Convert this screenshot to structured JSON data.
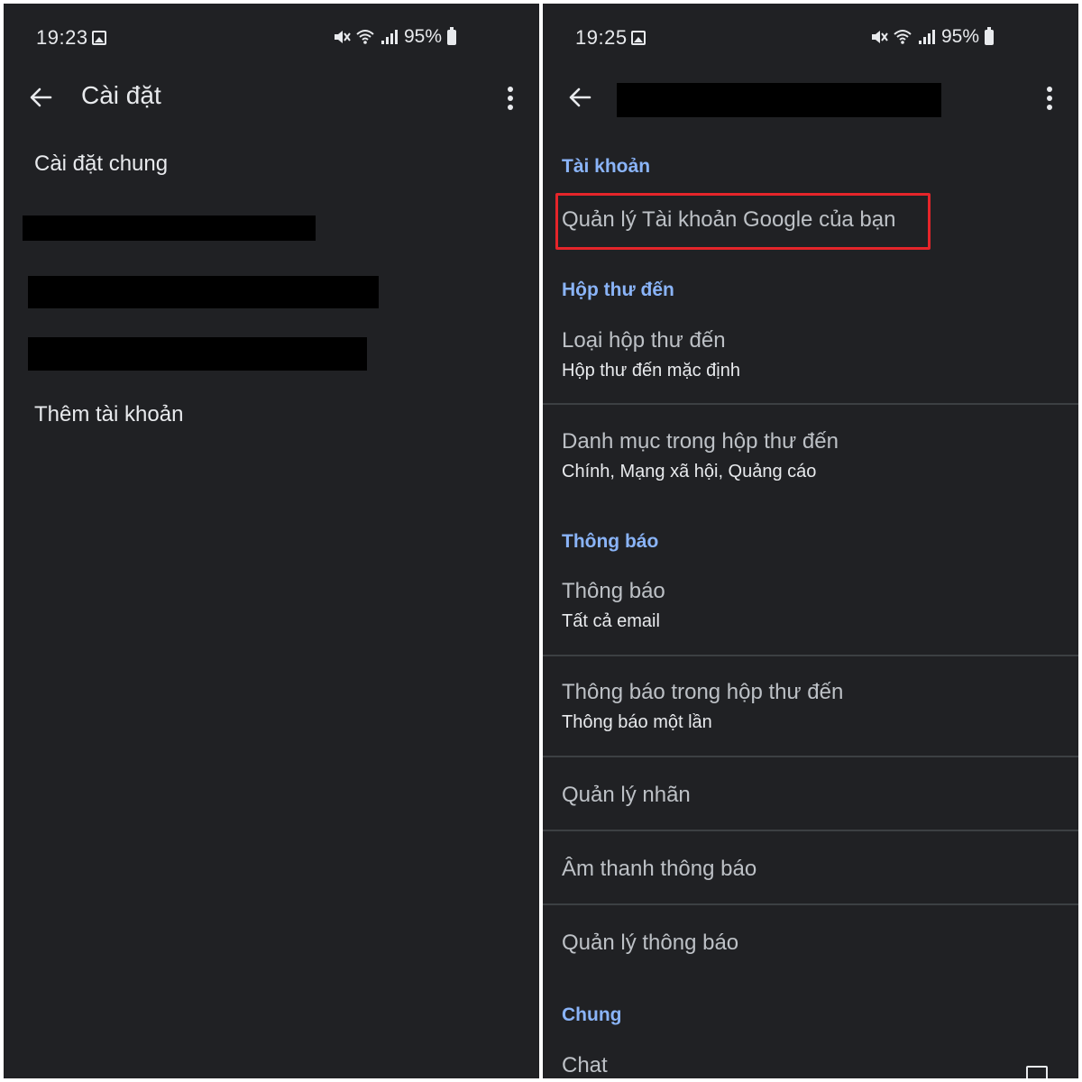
{
  "left": {
    "status": {
      "time": "19:23",
      "battery": "95%"
    },
    "app_bar": {
      "title": "Cài đặt"
    },
    "items": [
      {
        "label": "Cài đặt chung"
      },
      {
        "label": "Thêm tài khoản"
      }
    ]
  },
  "right": {
    "status": {
      "time": "19:25",
      "battery": "95%"
    },
    "sections": {
      "account": "Tài khoản",
      "inbox": "Hộp thư đến",
      "notifications": "Thông báo",
      "general": "Chung"
    },
    "items": {
      "manage_account": {
        "title": "Quản lý Tài khoản Google của bạn"
      },
      "inbox_type": {
        "title": "Loại hộp thư đến",
        "summary": "Hộp thư đến mặc định"
      },
      "inbox_categories": {
        "title": "Danh mục trong hộp thư đến",
        "summary": "Chính, Mạng xã hội, Quảng cáo"
      },
      "notifications": {
        "title": "Thông báo",
        "summary": "Tất cả email"
      },
      "inbox_notifications": {
        "title": "Thông báo trong hộp thư đến",
        "summary": "Thông báo một lần"
      },
      "manage_labels": {
        "title": "Quản lý nhãn"
      },
      "notification_sound": {
        "title": "Âm thanh thông báo"
      },
      "manage_notifications": {
        "title": "Quản lý thông báo"
      },
      "chat": {
        "title": "Chat"
      }
    }
  },
  "colors": {
    "background": "#202124",
    "section_header": "#8ab4f8",
    "highlight": "#e5252a",
    "redaction": "#000000"
  },
  "icons": [
    "gallery-icon",
    "mute-icon",
    "wifi-icon",
    "signal-icon",
    "battery-icon",
    "back-arrow-icon",
    "more-vert-icon",
    "checkbox-icon"
  ]
}
